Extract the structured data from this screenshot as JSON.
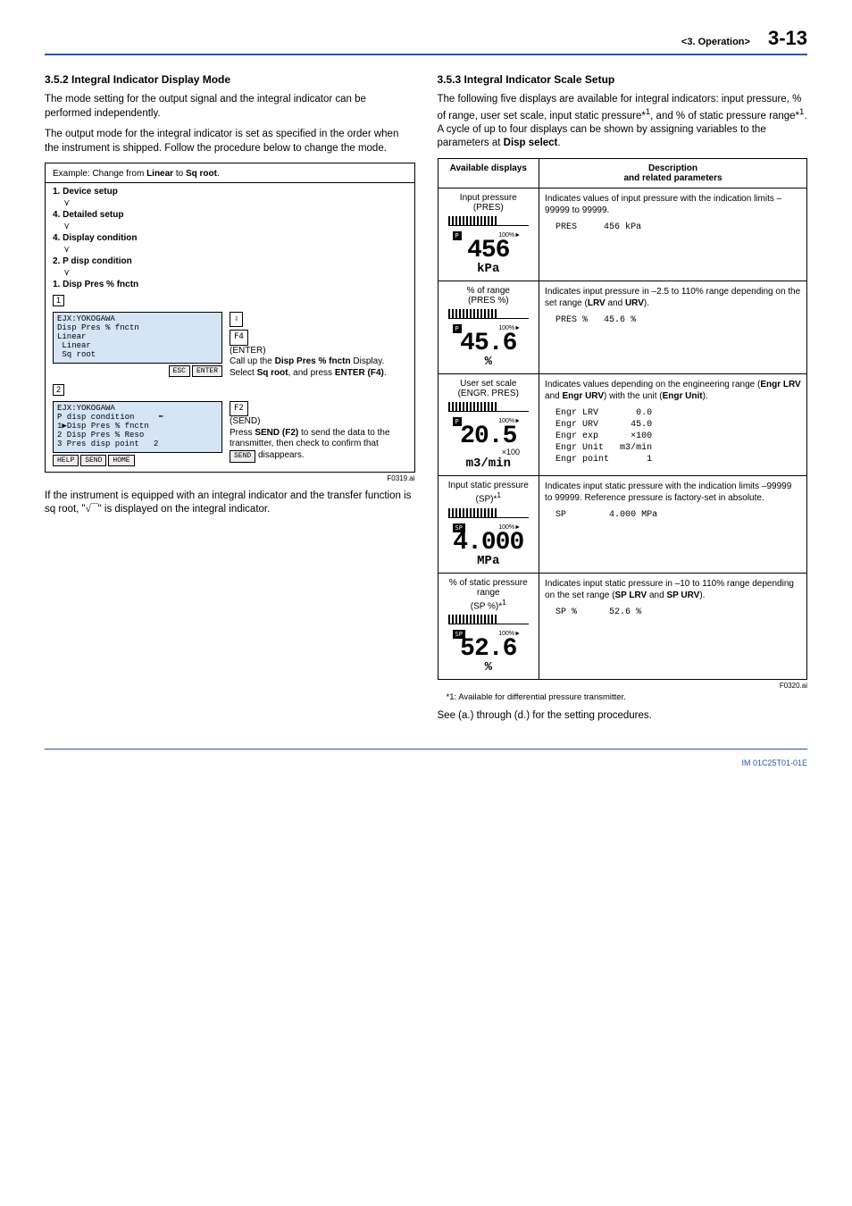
{
  "header": {
    "chapter": "<3. Operation>",
    "page": "3-13"
  },
  "left": {
    "h": "3.5.2   Integral Indicator Display Mode",
    "p1": "The mode setting for the output signal and the integral indicator can be performed independently.",
    "p2": "The output mode for the integral indicator is set as specified in the order when the instrument is shipped. Follow the procedure below to change the mode.",
    "example_label": "Example:  Change from ",
    "example_from": "Linear",
    "example_to_word": " to ",
    "example_to": "Sq root",
    "example_end": ".",
    "steps": {
      "s1": "1. Device setup",
      "s4a": "4. Detailed setup",
      "s4b": "4. Display condition",
      "s2": "2. P disp condition",
      "s1b": "1. Disp Pres % fnctn"
    },
    "lcd1": "EJX:YOKOGAWA\nDisp Pres % fnctn\nLinear\n Linear\n Sq root",
    "lcd1_keys": [
      "ESC",
      "ENTER"
    ],
    "r1_icon_top": "⇩",
    "r1_icon_bot": "F4",
    "r1_l1": "(ENTER)",
    "r1_l2a": "Call up the ",
    "r1_l2b": "Disp Pres % fnctn",
    "r1_l3a": "Display. Select ",
    "r1_l3b": "Sq root",
    "r1_l3c": ", and press ",
    "r1_l3d": "ENTER (F4)",
    "r1_l3e": ".",
    "lcd2": "EJX:YOKOGAWA\nP disp condition     ⬅\n1▶Disp Pres % fnctn\n2 Disp Pres % Reso\n3 Pres disp point   2",
    "lcd2_keys": [
      "HELP",
      "SEND",
      "HOME"
    ],
    "r2_icon": "F2",
    "r2_l1": "(SEND)",
    "r2_l2a": "Press ",
    "r2_l2b": "SEND (F2)",
    "r2_l2c": " to send the data to the transmitter, then check to confirm that ",
    "r2_key": "SEND",
    "r2_l2d": " disappears.",
    "figref1": "F0319.ai",
    "p3a": "If the instrument is equipped with an integral indicator and the transfer function is sq root, \"",
    "p3b": "\" is displayed on the integral indicator."
  },
  "right": {
    "h": "3.5.3   Integral Indicator Scale Setup",
    "p1a": "The following five displays are available for integral indicators: input pressure, % of range, user set scale, input static pressure*",
    "p1sup1": "1",
    "p1b": ", and % of static pressure range*",
    "p1sup2": "1",
    "p1c": ". A cycle of up to four displays can be shown by assigning variables to the parameters at ",
    "p1d": "Disp select",
    "p1e": ".",
    "th1": "Available displays",
    "th2_l1": "Description",
    "th2_l2": "and related parameters",
    "rows": [
      {
        "name": "Input pressure\n(PRES)",
        "seg": "456",
        "unit": "kPa",
        "badge": "P",
        "desc": "Indicates values of input pressure with the indication limits –99999 to 99999.",
        "code": "  PRES     456 kPa"
      },
      {
        "name": "% of range\n(PRES %)",
        "seg": "45.6",
        "unit": "%",
        "badge": "P",
        "desc_pre": "Indicates input pressure in –2.5 to 110% range depending on the set range (",
        "b1": "LRV",
        "mid": " and ",
        "b2": "URV",
        "desc_post": ").",
        "code": "  PRES %   45.6 %"
      },
      {
        "name": "User set scale\n(ENGR. PRES)",
        "seg": "20.5",
        "unit": "m3/min",
        "ext": "×100",
        "badge": "P",
        "desc_pre": "Indicates values depending on the engineering range (",
        "b1": "Engr LRV",
        "mid": " and ",
        "b2": "Engr URV",
        "mid2": ") with the unit (",
        "b3": "Engr Unit",
        "desc_post": ").",
        "code": "  Engr LRV       0.0\n  Engr URV      45.0\n  Engr exp      ×100\n  Engr Unit   m3/min\n  Engr point       1"
      },
      {
        "name_l1": "Input static pressure",
        "name_l2": "(SP)*",
        "sup": "1",
        "seg": "4.000",
        "unit": "MPa",
        "badge": "SP",
        "desc": "Indicates input static pressure with the indication limits –99999 to 99999. Reference pressure is factory-set in absolute.",
        "code": "  SP        4.000 MPa"
      },
      {
        "name_l1": "% of static pressure range",
        "name_l2": "(SP %)*",
        "sup": "1",
        "seg": "52.6",
        "unit": "%",
        "badge": "SP",
        "desc_pre": "Indicates input static pressure in –10 to 110% range depending on the set range (",
        "b1": "SP LRV",
        "mid": " and ",
        "b2": "SP URV",
        "desc_post": ").",
        "code": "  SP %      52.6 %"
      }
    ],
    "figref2": "F0320.ai",
    "note": "*1: Available for differential pressure transmitter.",
    "p2": "See (a.) through (d.) for the setting procedures."
  },
  "footer": {
    "doc": "IM 01C25T01-01E"
  }
}
